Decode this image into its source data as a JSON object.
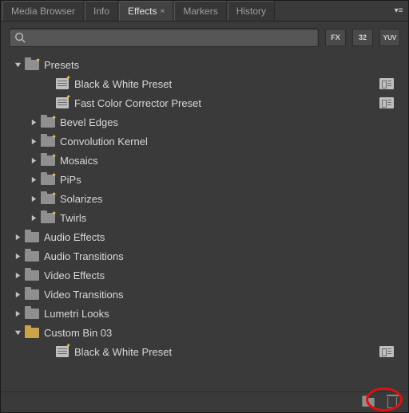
{
  "tabs": [
    {
      "label": "Media Browser",
      "active": false
    },
    {
      "label": "Info",
      "active": false
    },
    {
      "label": "Effects",
      "active": true,
      "closable": true
    },
    {
      "label": "Markers",
      "active": false
    },
    {
      "label": "History",
      "active": false
    }
  ],
  "search": {
    "value": "",
    "placeholder": ""
  },
  "toolbar": {
    "btn_fx": "FX",
    "btn_32": "32",
    "btn_yuv": "YUV"
  },
  "tree": [
    {
      "depth": 0,
      "arrow": "down",
      "icon": "folder-fx",
      "label": "Presets"
    },
    {
      "depth": 2,
      "arrow": "none",
      "icon": "preset",
      "label": "Black & White Preset",
      "badge": true
    },
    {
      "depth": 2,
      "arrow": "none",
      "icon": "preset",
      "label": "Fast Color Corrector Preset",
      "badge": true
    },
    {
      "depth": 1,
      "arrow": "right",
      "icon": "folder-fx",
      "label": "Bevel Edges"
    },
    {
      "depth": 1,
      "arrow": "right",
      "icon": "folder-fx",
      "label": "Convolution Kernel"
    },
    {
      "depth": 1,
      "arrow": "right",
      "icon": "folder-fx",
      "label": "Mosaics"
    },
    {
      "depth": 1,
      "arrow": "right",
      "icon": "folder-fx",
      "label": "PiPs"
    },
    {
      "depth": 1,
      "arrow": "right",
      "icon": "folder-fx",
      "label": "Solarizes"
    },
    {
      "depth": 1,
      "arrow": "right",
      "icon": "folder-fx",
      "label": "Twirls"
    },
    {
      "depth": 0,
      "arrow": "right",
      "icon": "folder",
      "label": "Audio Effects"
    },
    {
      "depth": 0,
      "arrow": "right",
      "icon": "folder",
      "label": "Audio Transitions"
    },
    {
      "depth": 0,
      "arrow": "right",
      "icon": "folder",
      "label": "Video Effects"
    },
    {
      "depth": 0,
      "arrow": "right",
      "icon": "folder",
      "label": "Video Transitions"
    },
    {
      "depth": 0,
      "arrow": "right",
      "icon": "folder",
      "label": "Lumetri Looks"
    },
    {
      "depth": 0,
      "arrow": "down",
      "icon": "folder-open",
      "label": "Custom Bin 03"
    },
    {
      "depth": 2,
      "arrow": "none",
      "icon": "preset",
      "label": "Black & White Preset",
      "badge": true
    }
  ]
}
